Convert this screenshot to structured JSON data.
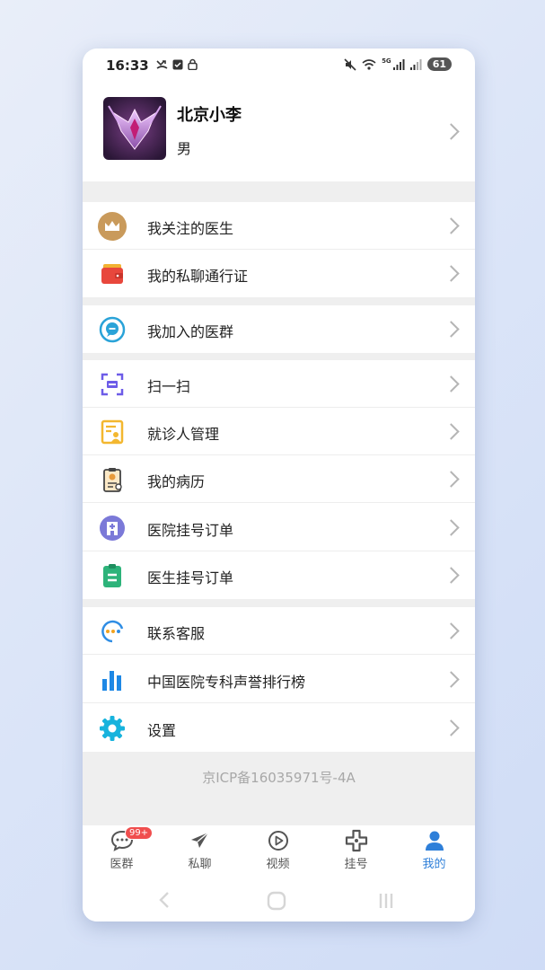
{
  "status_bar": {
    "time": "16:33",
    "network": "5G",
    "battery": "61"
  },
  "profile": {
    "name": "北京小李",
    "gender": "男"
  },
  "menu": {
    "followed_doctors": "我关注的医生",
    "private_chat_pass": "我的私聊通行证",
    "joined_groups": "我加入的医群",
    "scan": "扫一扫",
    "patient_management": "就诊人管理",
    "medical_records": "我的病历",
    "hospital_orders": "医院挂号订单",
    "doctor_orders": "医生挂号订单",
    "customer_service": "联系客服",
    "ranking": "中国医院专科声誉排行榜",
    "settings": "设置"
  },
  "footer": {
    "icp": "京ICP备16035971号-4A"
  },
  "tabbar": {
    "tabs": [
      {
        "label": "医群",
        "icon": "chat-bubble-icon",
        "badge": "99+"
      },
      {
        "label": "私聊",
        "icon": "paper-plane-icon"
      },
      {
        "label": "视频",
        "icon": "play-circle-icon"
      },
      {
        "label": "挂号",
        "icon": "medical-cross-icon"
      },
      {
        "label": "我的",
        "icon": "person-icon",
        "active": true
      }
    ]
  },
  "colors": {
    "active_tab": "#2e7fd9",
    "badge": "#f04e4e",
    "section_gap": "#efefef"
  }
}
